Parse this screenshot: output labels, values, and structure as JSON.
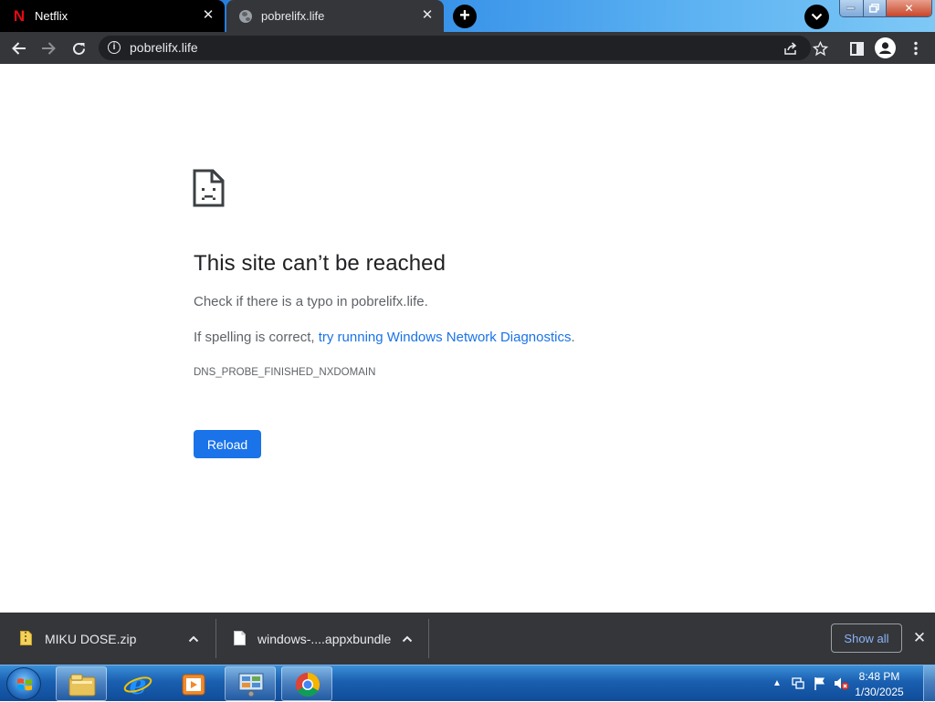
{
  "browser": {
    "tabs": [
      {
        "title": "Netflix",
        "icon": "netflix-icon",
        "active": false
      },
      {
        "title": "pobrelifx.life",
        "icon": "globe-icon",
        "active": true
      }
    ],
    "new_tab_label": "+",
    "address": "pobrelifx.life"
  },
  "error_page": {
    "title": "This site can’t be reached",
    "check_text": "Check if there is a typo in pobrelifx.life.",
    "spelling_prefix": "If spelling is correct, ",
    "diagnostics_link": "try running Windows Network Diagnostics",
    "spelling_suffix": ".",
    "error_code": "DNS_PROBE_FINISHED_NXDOMAIN",
    "reload_label": "Reload"
  },
  "downloads": {
    "items": [
      {
        "name": "MIKU DOSE.zip",
        "icon": "zip-file-icon"
      },
      {
        "name": "windows-....appxbundle",
        "icon": "file-icon"
      }
    ],
    "show_all_label": "Show all"
  },
  "taskbar": {
    "apps": [
      "file-explorer-icon",
      "internet-explorer-icon",
      "media-player-icon",
      "control-panel-icon",
      "chrome-icon"
    ],
    "clock_time": "8:48 PM",
    "clock_date": "1/30/2025"
  },
  "colors": {
    "accent": "#1a73e8",
    "toolbar": "#35363a",
    "netflix_red": "#e50914"
  }
}
